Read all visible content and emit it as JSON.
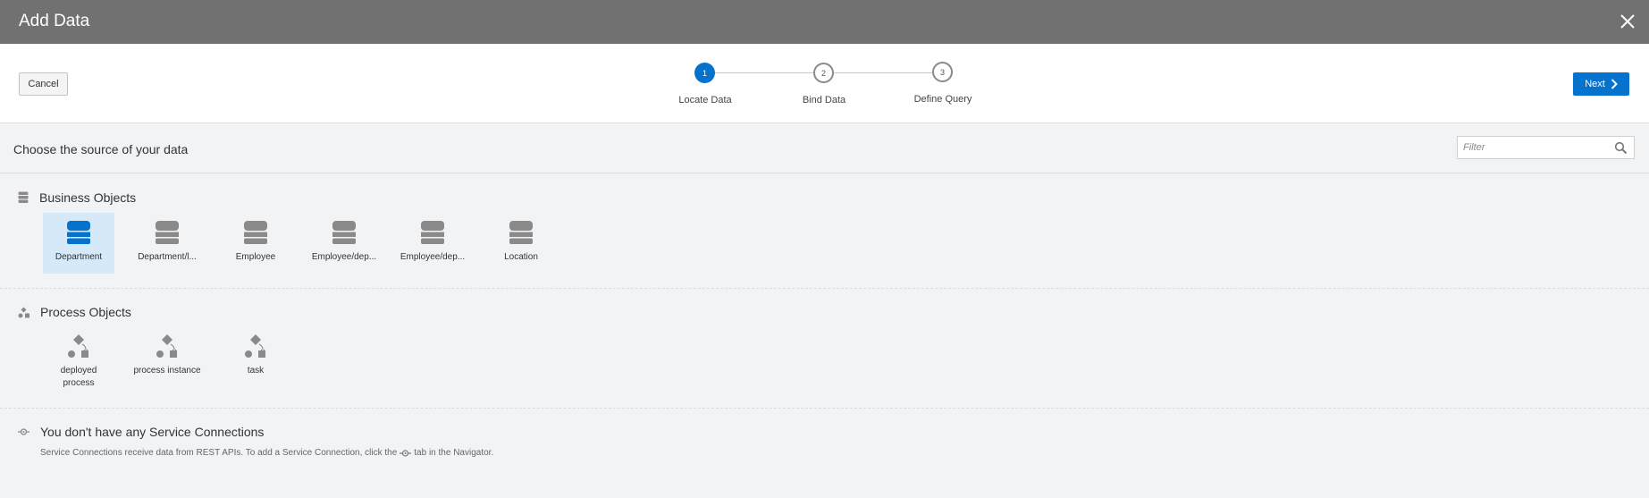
{
  "dialog": {
    "title": "Add Data",
    "close_icon": "close-icon"
  },
  "toolbar": {
    "cancel_label": "Cancel",
    "next_label": "Next"
  },
  "wizard": {
    "steps": [
      {
        "number": "1",
        "label": "Locate Data",
        "state": "active"
      },
      {
        "number": "2",
        "label": "Bind Data",
        "state": "inactive"
      },
      {
        "number": "3",
        "label": "Define Query",
        "state": "inactive"
      }
    ]
  },
  "source": {
    "heading": "Choose the source of your data",
    "filter_placeholder": "Filter"
  },
  "business_objects": {
    "heading": "Business Objects",
    "items": [
      {
        "label": "Department",
        "selected": true
      },
      {
        "label": "Department/l...",
        "selected": false
      },
      {
        "label": "Employee",
        "selected": false
      },
      {
        "label": "Employee/dep...",
        "selected": false
      },
      {
        "label": "Employee/dep...",
        "selected": false
      },
      {
        "label": "Location",
        "selected": false
      }
    ]
  },
  "process_objects": {
    "heading": "Process Objects",
    "items": [
      {
        "label": "deployed process"
      },
      {
        "label": "process instance"
      },
      {
        "label": "task"
      }
    ]
  },
  "service_connections": {
    "heading": "You don't have any Service Connections",
    "description_before": "Service Connections receive data from REST APIs. To add a Service Connection, click the",
    "description_after": "tab in the Navigator."
  },
  "colors": {
    "accent": "#0572ce",
    "titlebar": "#717171",
    "selected_tile": "#d6e9f8",
    "icon_gray": "#8a8a8a"
  }
}
